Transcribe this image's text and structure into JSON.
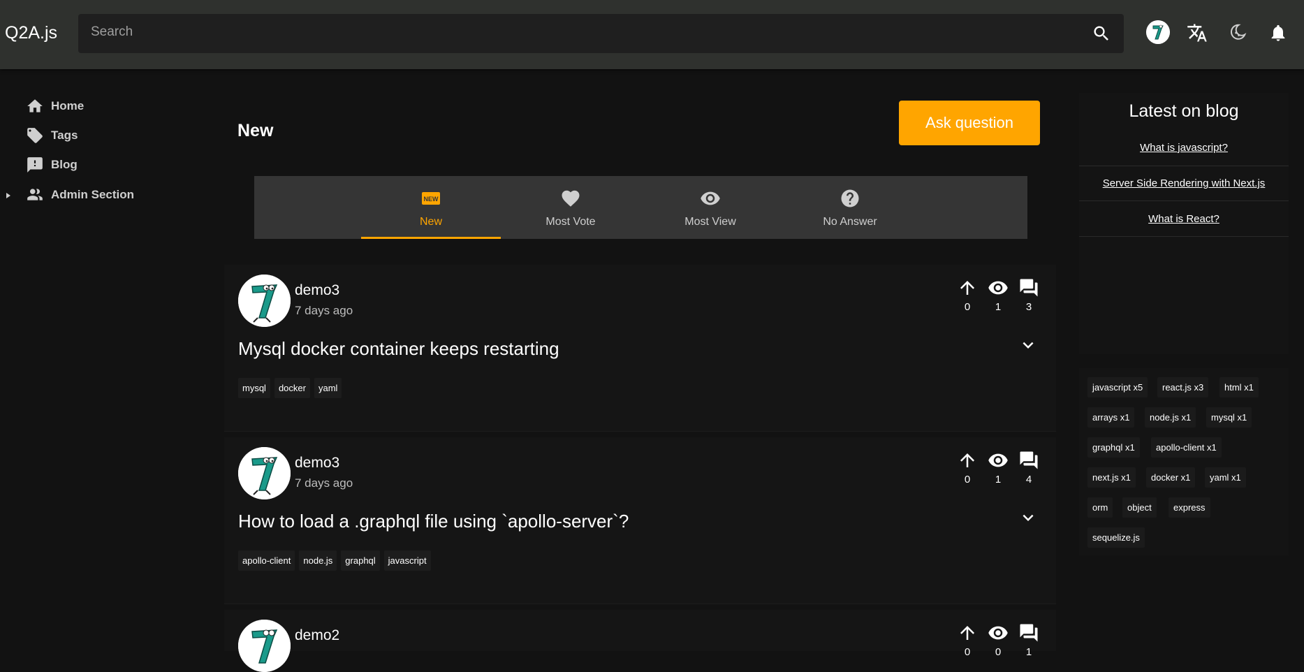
{
  "header": {
    "logo": "Q2A.js",
    "search_placeholder": "Search"
  },
  "sidebar": {
    "items": [
      {
        "label": "Home",
        "icon": "home-icon"
      },
      {
        "label": "Tags",
        "icon": "tag-icon"
      },
      {
        "label": "Blog",
        "icon": "feedback-icon"
      },
      {
        "label": "Admin Section",
        "icon": "people-icon"
      }
    ]
  },
  "main": {
    "title": "New",
    "ask_button": "Ask question",
    "tabs": [
      {
        "label": "New",
        "icon": "new-badge-icon",
        "active": true
      },
      {
        "label": "Most Vote",
        "icon": "heart-icon"
      },
      {
        "label": "Most View",
        "icon": "eye-icon"
      },
      {
        "label": "No Answer",
        "icon": "help-circle-icon"
      }
    ],
    "questions": [
      {
        "user": "demo3",
        "time": "7 days ago",
        "votes": "0",
        "views": "1",
        "answers": "3",
        "title": "Mysql docker container keeps restarting",
        "tags": [
          "mysql",
          "docker",
          "yaml"
        ]
      },
      {
        "user": "demo3",
        "time": "7 days ago",
        "votes": "0",
        "views": "1",
        "answers": "4",
        "title": "How to load a .graphql file using `apollo-server`?",
        "tags": [
          "apollo-client",
          "node.js",
          "graphql",
          "javascript"
        ]
      },
      {
        "user": "demo2",
        "time": "",
        "votes": "0",
        "views": "0",
        "answers": "1",
        "title": "",
        "tags": []
      }
    ]
  },
  "blog": {
    "title": "Latest on blog",
    "links": [
      "What is javascript?",
      "Server Side Rendering with Next.js",
      "What is React?"
    ]
  },
  "popular_tags": [
    "javascript x5",
    "react.js x3",
    "html x1",
    "arrays x1",
    "node.js x1",
    "mysql x1",
    "graphql x1",
    "apollo-client x1",
    "next.js x1",
    "docker x1",
    "yaml x1",
    "orm",
    "object",
    "express",
    "sequelize.js"
  ],
  "colors": {
    "accent": "#ffa500",
    "header_bg": "#2f312e",
    "page_bg": "#121212"
  }
}
